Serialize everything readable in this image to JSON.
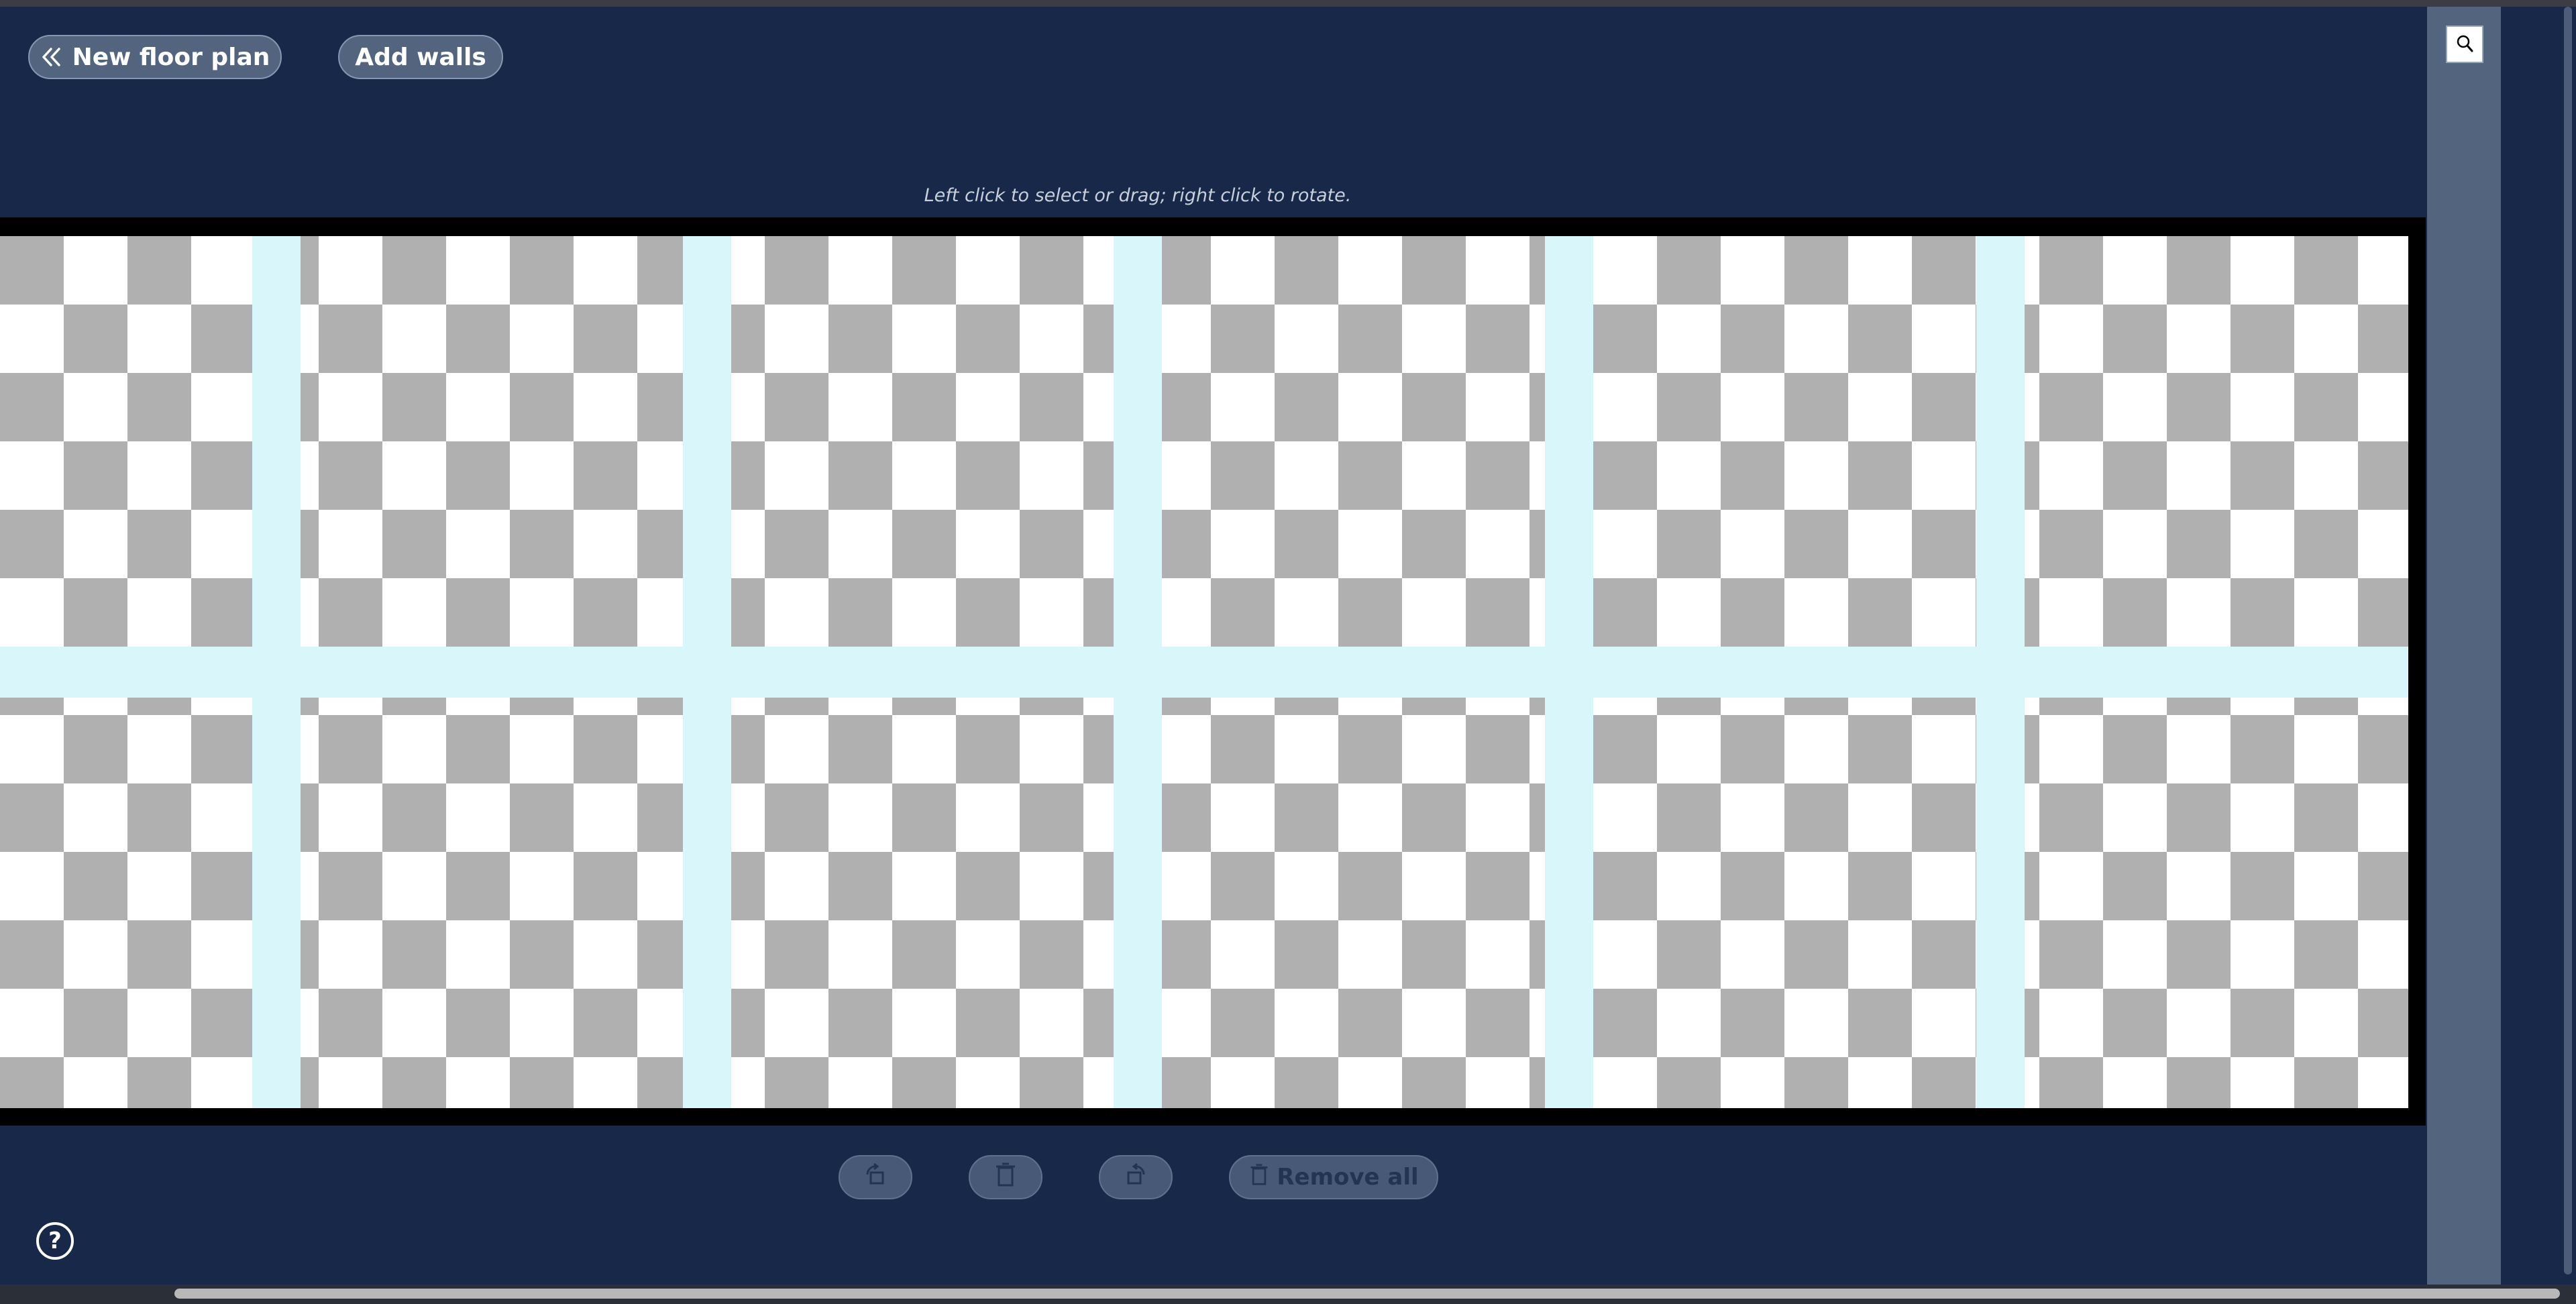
{
  "toolbar": {
    "back_label": "New floor plan",
    "walls_label": "Add walls"
  },
  "canvas": {
    "hint": "Left click to select or drag; right click to rotate."
  },
  "tools": {
    "remove_all_label": "Remove all"
  },
  "help": {
    "label": "?"
  },
  "colors": {
    "background": "#172849",
    "button": "#53647f",
    "checker_dark": "#b0b0b0",
    "checker_light": "#ffffff",
    "grid_line": "#d9f6fb",
    "side_panel": "#53647f"
  },
  "icons": {
    "back": "chevrons-left-icon",
    "rotate_left": "rotate-left-icon",
    "delete": "trash-icon",
    "rotate_right": "rotate-right-icon",
    "remove_all": "trash-icon",
    "help": "help-circle-icon",
    "search": "search-icon"
  }
}
